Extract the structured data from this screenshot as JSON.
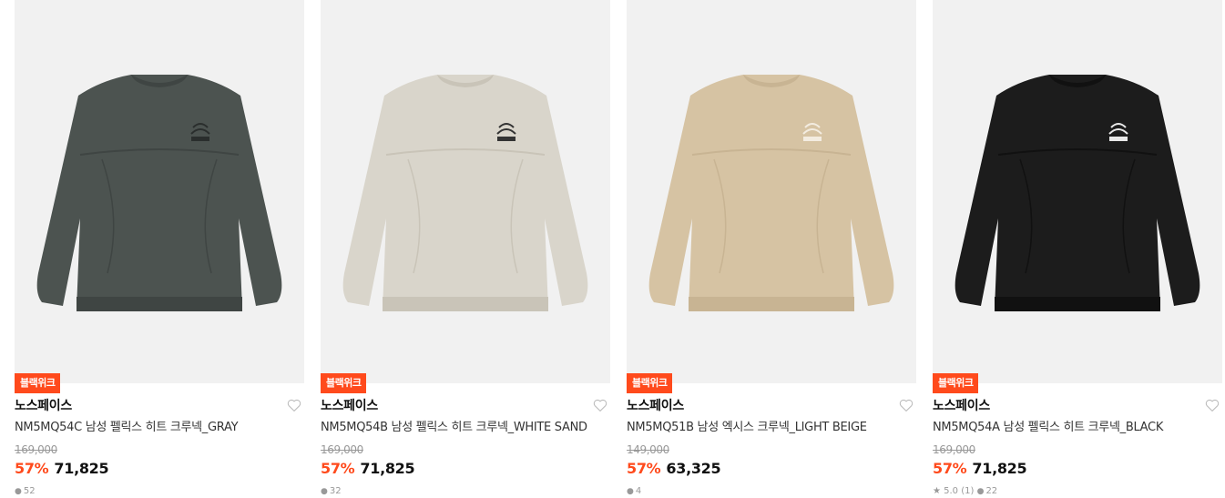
{
  "products": [
    {
      "badge": "블랙위크",
      "brand": "노스페이스",
      "name": "NM5MQ54C 남성 펠릭스 히트 크루넥_GRAY",
      "original_price": "169,000",
      "discount": "57%",
      "price": "71,825",
      "rating": "",
      "reviews": "52",
      "garment_color": "#4c5350",
      "garment_shade": "#3f4543",
      "logo_color": "#2a2e2d"
    },
    {
      "badge": "블랙위크",
      "brand": "노스페이스",
      "name": "NM5MQ54B 남성 펠릭스 히트 크루넥_WHITE SAND",
      "original_price": "169,000",
      "discount": "57%",
      "price": "71,825",
      "rating": "",
      "reviews": "32",
      "garment_color": "#d9d5cb",
      "garment_shade": "#c9c4b8",
      "logo_color": "#333333"
    },
    {
      "badge": "블랙위크",
      "brand": "노스페이스",
      "name": "NM5MQ51B 남성 엑시스 크루넥_LIGHT BEIGE",
      "original_price": "149,000",
      "discount": "57%",
      "price": "63,325",
      "rating": "",
      "reviews": "4",
      "garment_color": "#d6c3a3",
      "garment_shade": "#c8b493",
      "logo_color": "#f3ece0"
    },
    {
      "badge": "블랙위크",
      "brand": "노스페이스",
      "name": "NM5MQ54A 남성 펠릭스 히트 크루넥_BLACK",
      "original_price": "169,000",
      "discount": "57%",
      "price": "71,825",
      "rating": "★ 5.0 (1)",
      "reviews": "22",
      "garment_color": "#1c1c1c",
      "garment_shade": "#111111",
      "logo_color": "#e8e8e8"
    }
  ],
  "colors": {
    "accent": "#ff4a1c",
    "image_bg": "#f1f1f1"
  },
  "icons": {
    "wishlist": "heart-outline-icon",
    "review": "speech-bubble-icon",
    "rating": "star-icon"
  }
}
